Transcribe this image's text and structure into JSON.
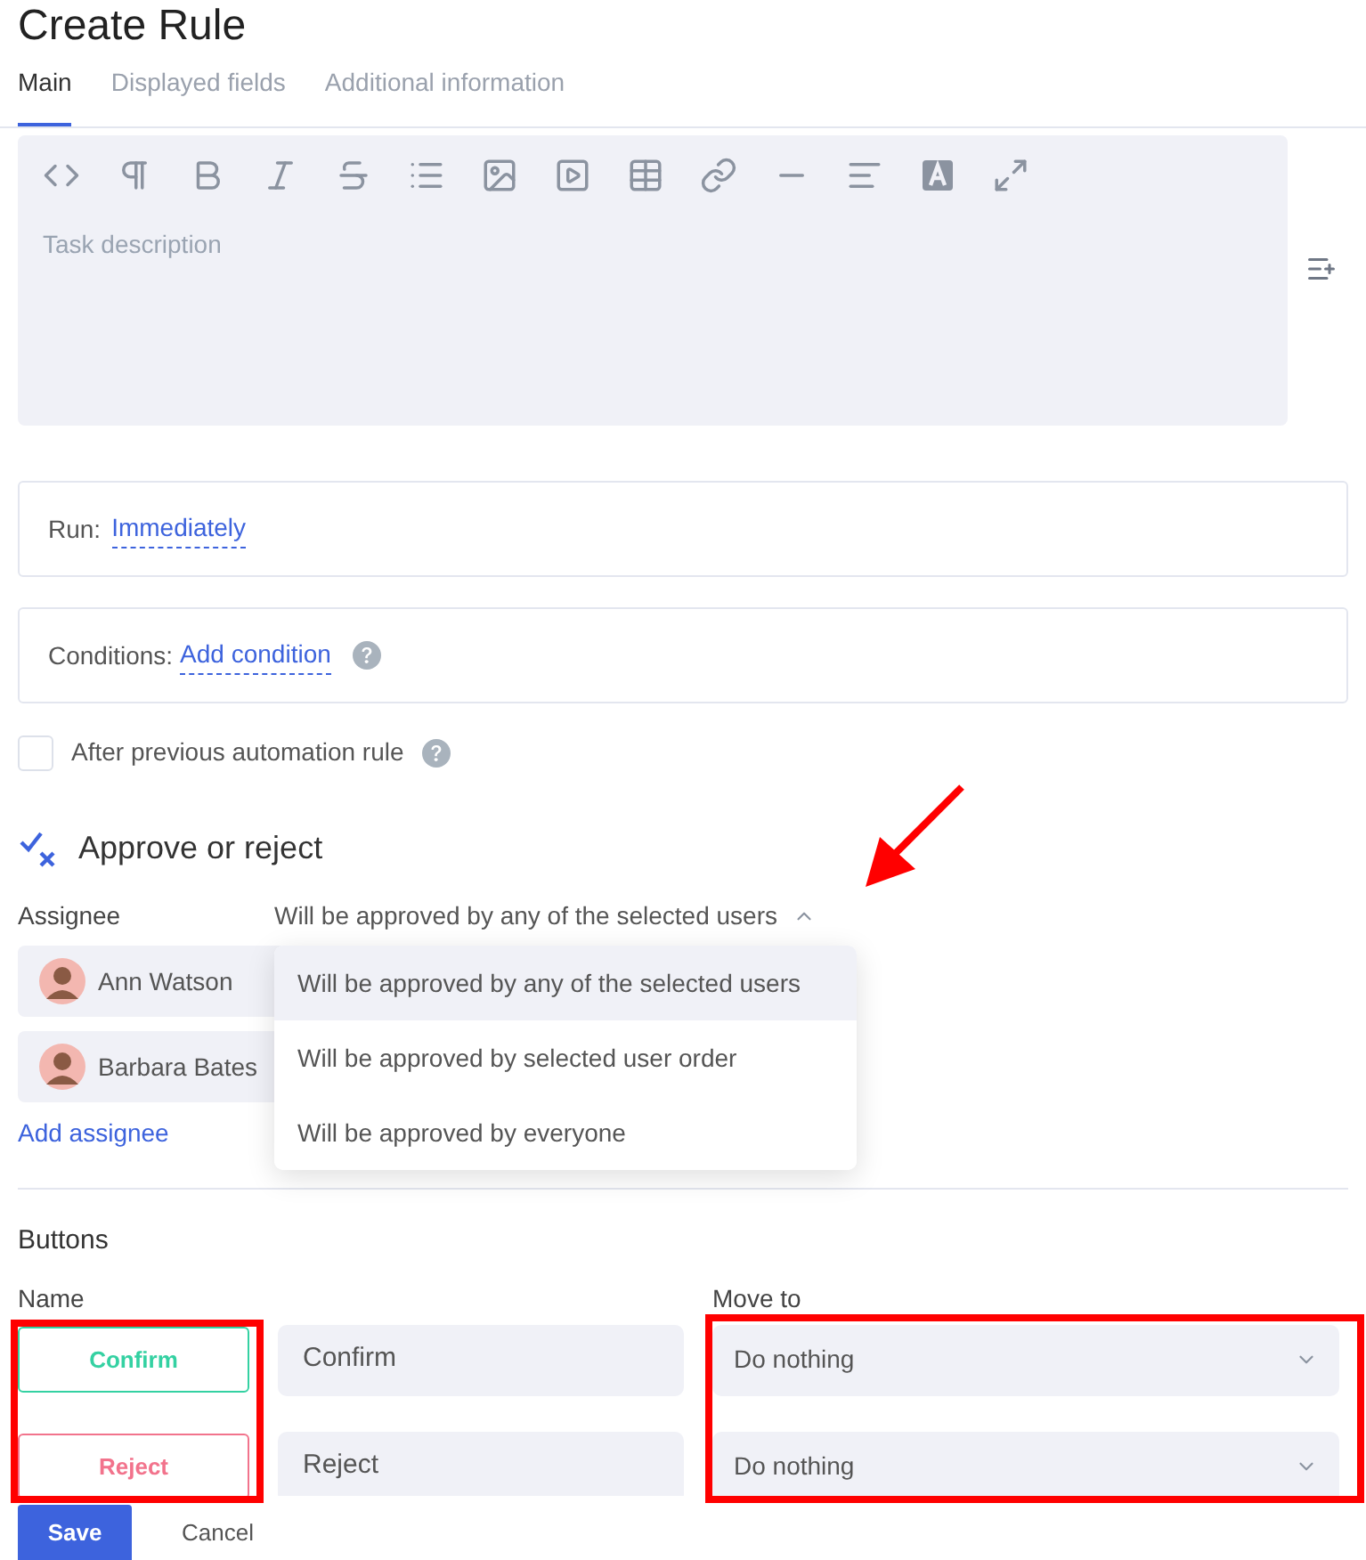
{
  "title": "Create Rule",
  "tabs": [
    {
      "label": "Main",
      "selected": true
    },
    {
      "label": "Displayed fields",
      "selected": false
    },
    {
      "label": "Additional information",
      "selected": false
    }
  ],
  "editor": {
    "placeholder": "Task description"
  },
  "run": {
    "label": "Run:",
    "value": "Immediately"
  },
  "conditions": {
    "label": "Conditions:",
    "link": "Add condition"
  },
  "after_previous": {
    "label": "After previous automation rule",
    "checked": false
  },
  "section": {
    "title": "Approve or reject"
  },
  "assignee": {
    "label": "Assignee",
    "mode": "Will be approved by any of the selected users",
    "expanded": true,
    "users": [
      {
        "name": "Ann Watson"
      },
      {
        "name": "Barbara Bates"
      }
    ],
    "add": "Add assignee",
    "options": [
      {
        "label": "Will be approved by any of the selected users",
        "selected": true
      },
      {
        "label": "Will be approved by selected user order",
        "selected": false
      },
      {
        "label": "Will be approved by everyone",
        "selected": false
      }
    ]
  },
  "buttons": {
    "title": "Buttons",
    "name_header": "Name",
    "move_header": "Move to",
    "rows": [
      {
        "preview": "Confirm",
        "color": "#34d1a2",
        "name": "Confirm",
        "move_to": "Do nothing"
      },
      {
        "preview": "Reject",
        "color": "#f2738c",
        "name": "Reject",
        "move_to": "Do nothing"
      }
    ]
  },
  "footer": {
    "save": "Save",
    "cancel": "Cancel"
  }
}
